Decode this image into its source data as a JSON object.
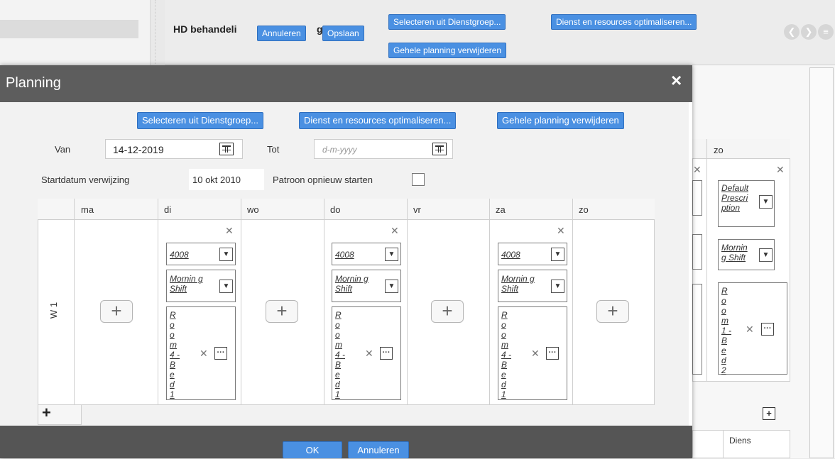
{
  "background": {
    "title": "HD behandeli",
    "title_tail": "g",
    "buttons": {
      "cancel": "Annuleren",
      "save": "Opslaan",
      "select_group": "Selecteren uit Dienstgroep...",
      "optimize": "Dienst en resources optimaliseren...",
      "delete_plan": "Gehele planning verwijderen"
    },
    "grid": {
      "day": "zo",
      "entry": "Default Prescri ption",
      "shift": "Mornin g Shift",
      "room": "Ro o m 1 - Be d 2",
      "bottom_col": "Diens"
    }
  },
  "modal": {
    "title": "Planning",
    "close_icon": "×",
    "toolbar": {
      "select_group": "Selecteren uit Dienstgroep...",
      "optimize": "Dienst en resources optimaliseren...",
      "delete_plan": "Gehele planning verwijderen"
    },
    "form": {
      "from_label": "Van",
      "from_value": "14-12-2019",
      "to_label": "Tot",
      "to_placeholder": "d-m-yyyy",
      "start_ref_label": "Startdatum verwijzing",
      "start_ref_value": "10 okt 2010",
      "restart_label": "Patroon opnieuw starten"
    },
    "table": {
      "days": [
        "ma",
        "di",
        "wo",
        "do",
        "vr",
        "za",
        "zo"
      ],
      "week_label": "W 1",
      "cell_code": "4008",
      "cell_shift": "Mornin g Shift",
      "cell_room": "Ro o m 4 - Be d 1"
    },
    "footer": {
      "ok": "OK",
      "cancel": "Annuleren"
    }
  }
}
